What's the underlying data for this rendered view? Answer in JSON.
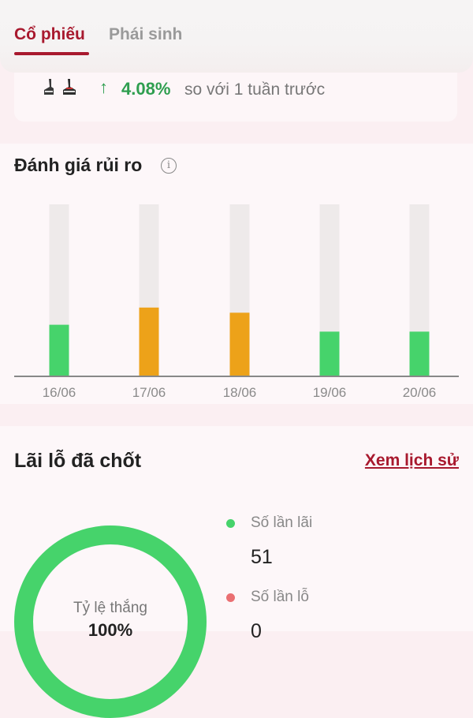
{
  "tabs": {
    "stocks": "Cổ phiếu",
    "derivatives": "Phái sinh"
  },
  "weekly": {
    "arrow": "↑",
    "change": "4.08%",
    "comparison": "so với 1 tuần trước"
  },
  "risk": {
    "title": "Đánh giá rủi ro",
    "info_icon": "i"
  },
  "chart_data": {
    "type": "bar",
    "categories": [
      "16/06",
      "17/06",
      "18/06",
      "19/06",
      "20/06"
    ],
    "values": [
      30,
      40,
      37,
      26,
      26
    ],
    "ylim": [
      0,
      100
    ],
    "bar_colors": [
      "#46d36b",
      "#eda219",
      "#eda219",
      "#46d36b",
      "#46d36b"
    ],
    "track_color": "#eeeaea",
    "axis_color": "#888888",
    "grid": false
  },
  "pl": {
    "title": "Lãi lỗ đã chốt",
    "history_link": "Xem lịch sử",
    "win_rate_label": "Tỷ lệ thắng",
    "win_rate_value": "100%",
    "legend": [
      {
        "label": "Số lần lãi",
        "value": "51",
        "color": "#46d36b"
      },
      {
        "label": "Số lần lỗ",
        "value": "0",
        "color": "#ea6f72"
      }
    ]
  }
}
